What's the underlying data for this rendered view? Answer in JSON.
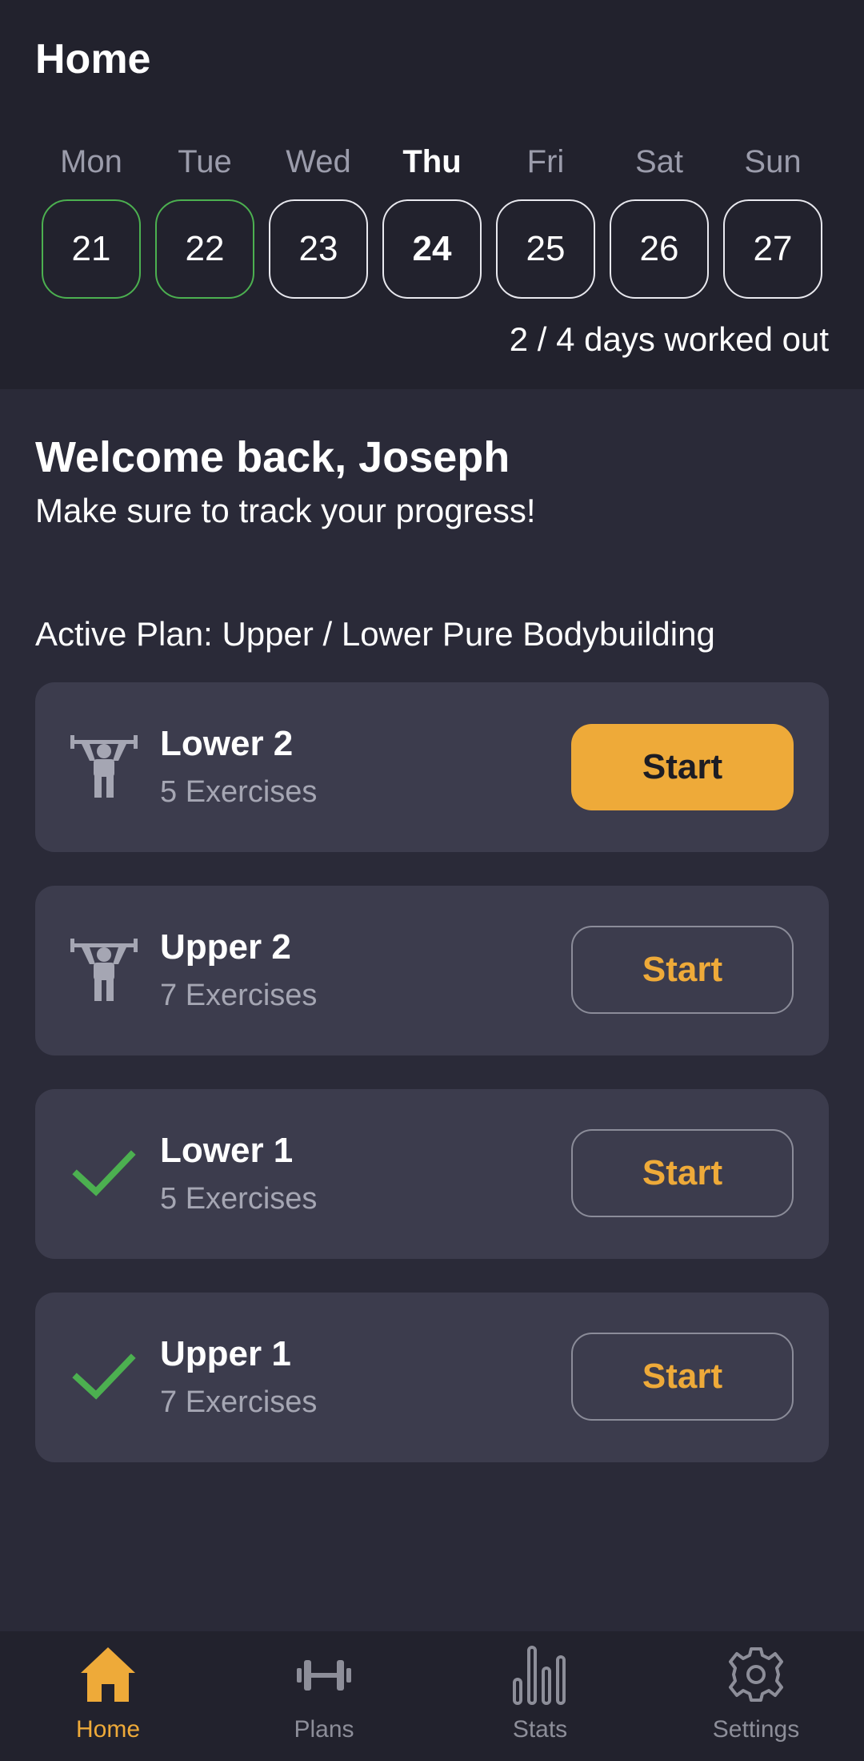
{
  "header": {
    "title": "Home",
    "days_summary": "2 / 4 days worked out"
  },
  "week": [
    {
      "label": "Mon",
      "date": "21",
      "state": "done"
    },
    {
      "label": "Tue",
      "date": "22",
      "state": "done"
    },
    {
      "label": "Wed",
      "date": "23",
      "state": "none"
    },
    {
      "label": "Thu",
      "date": "24",
      "state": "today"
    },
    {
      "label": "Fri",
      "date": "25",
      "state": "none"
    },
    {
      "label": "Sat",
      "date": "26",
      "state": "none"
    },
    {
      "label": "Sun",
      "date": "27",
      "state": "none"
    }
  ],
  "main": {
    "welcome": "Welcome back, Joseph",
    "subtitle": "Make sure to track your progress!",
    "active_plan": "Active Plan: Upper / Lower Pure Bodybuilding"
  },
  "workouts": [
    {
      "name": "Lower 2",
      "exercises": "5 Exercises",
      "icon": "weightlifter-icon",
      "button": "Start",
      "primary": true
    },
    {
      "name": "Upper 2",
      "exercises": "7 Exercises",
      "icon": "weightlifter-icon",
      "button": "Start",
      "primary": false
    },
    {
      "name": "Lower 1",
      "exercises": "5 Exercises",
      "icon": "checkmark-icon",
      "button": "Start",
      "primary": false
    },
    {
      "name": "Upper 1",
      "exercises": "7 Exercises",
      "icon": "checkmark-icon",
      "button": "Start",
      "primary": false
    }
  ],
  "nav": [
    {
      "label": "Home",
      "icon": "home-icon",
      "active": true
    },
    {
      "label": "Plans",
      "icon": "dumbbell-icon",
      "active": false
    },
    {
      "label": "Stats",
      "icon": "bar-chart-icon",
      "active": false
    },
    {
      "label": "Settings",
      "icon": "gear-icon",
      "active": false
    }
  ],
  "colors": {
    "accent": "#eeaa39",
    "done": "#4cb050",
    "card": "#3c3c4d",
    "background": "#2a2a38",
    "header": "#22222d"
  }
}
